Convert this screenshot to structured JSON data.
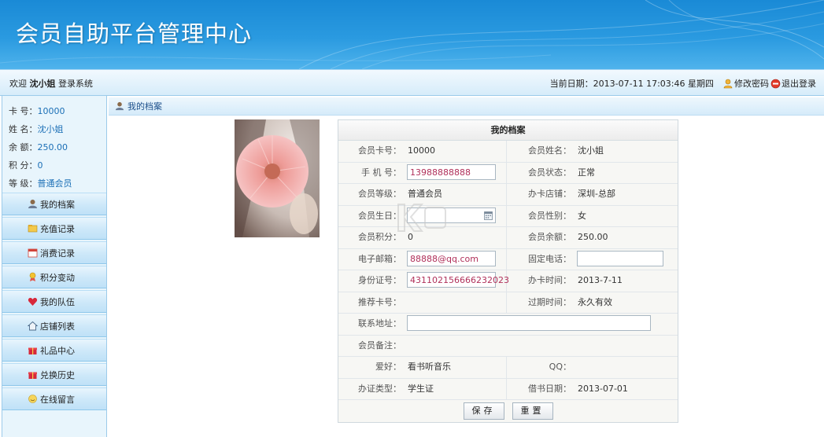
{
  "header": {
    "title": "会员自助平台管理中心"
  },
  "topbar": {
    "welcome_prefix": "欢迎",
    "username": "沈小姐",
    "welcome_suffix": "登录系统",
    "date_text": "当前日期：2013-07-11 17:03:46 星期四",
    "change_password": "修改密码",
    "logout": "退出登录"
  },
  "member_info": [
    {
      "label": "卡 号：",
      "value": "10000"
    },
    {
      "label": "姓 名：",
      "value": "沈小姐"
    },
    {
      "label": "余 额：",
      "value": "250.00"
    },
    {
      "label": "积 分：",
      "value": "0"
    },
    {
      "label": "等 级：",
      "value": "普通会员"
    }
  ],
  "menu": [
    {
      "label": "我的档案",
      "icon": "user-icon"
    },
    {
      "label": "充值记录",
      "icon": "folder-icon"
    },
    {
      "label": "消费记录",
      "icon": "calendar-icon"
    },
    {
      "label": "积分变动",
      "icon": "medal-icon"
    },
    {
      "label": "我的队伍",
      "icon": "heart-icon"
    },
    {
      "label": "店铺列表",
      "icon": "home-icon"
    },
    {
      "label": "礼品中心",
      "icon": "gift-icon"
    },
    {
      "label": "兑换历史",
      "icon": "gift-icon"
    },
    {
      "label": "在线留言",
      "icon": "smiley-icon"
    }
  ],
  "main": {
    "section_title": "我的档案",
    "form_title": "我的档案",
    "fields": {
      "card_no_label": "会员卡号：",
      "card_no": "10000",
      "name_label": "会员姓名：",
      "name": "沈小姐",
      "phone_label": "手 机 号：",
      "phone": "13988888888",
      "status_label": "会员状态：",
      "status": "正常",
      "level_label": "会员等级：",
      "level": "普通会员",
      "store_label": "办卡店铺：",
      "store": "深圳-总部",
      "birthday_label": "会员生日：",
      "birthday": "",
      "gender_label": "会员性别：",
      "gender": "女",
      "points_label": "会员积分：",
      "points": "0",
      "balance_label": "会员余额：",
      "balance": "250.00",
      "email_label": "电子邮箱：",
      "email": "88888@qq.com",
      "landline_label": "固定电话：",
      "landline": "",
      "idcard_label": "身份证号：",
      "idcard": "431102156666232023",
      "open_time_label": "办卡时间：",
      "open_time": "2013-7-11",
      "referrer_label": "推荐卡号：",
      "referrer": "",
      "expire_label": "过期时间：",
      "expire": "永久有效",
      "address_label": "联系地址：",
      "address": "",
      "remark_label": "会员备注：",
      "remark": "",
      "hobby_label": "爱好：",
      "hobby": "看书听音乐",
      "qq_label": "QQ：",
      "qq": "",
      "cert_type_label": "办证类型：",
      "cert_type": "学生证",
      "cert_date_label": "借书日期：",
      "cert_date": "2013-07-01"
    },
    "save_button": "保存",
    "reset_button": "重置"
  },
  "colors": {
    "banner": "#1a8ad6",
    "link_value": "#1b6fb6",
    "input_text": "#b0305a"
  }
}
